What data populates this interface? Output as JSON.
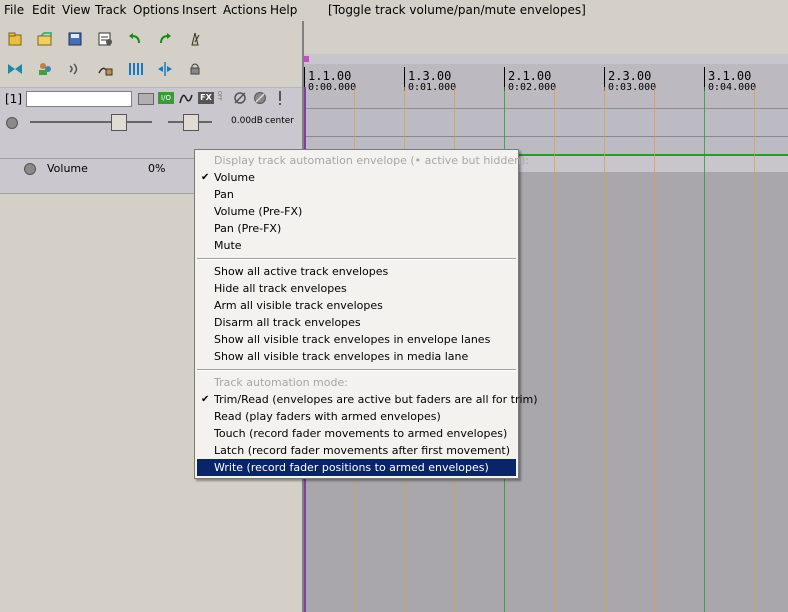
{
  "menubar": {
    "items": [
      "File",
      "Edit",
      "View",
      "Track",
      "Options",
      "Insert",
      "Actions",
      "Help"
    ],
    "status": "[Toggle track volume/pan/mute envelopes]"
  },
  "track": {
    "number": "[1]",
    "name": "",
    "volume_readout": "0.00dB",
    "pan_readout": "center",
    "fx_label": "FX",
    "off_label": "OFF",
    "io_label": "I/O"
  },
  "envelope_lane": {
    "name": "Volume",
    "value": "0%"
  },
  "ruler": {
    "bars": [
      "1.1.00",
      "1.3.00",
      "2.1.00",
      "2.3.00",
      "3.1.00"
    ],
    "times": [
      "0:00.000",
      "0:01.000",
      "0:02.000",
      "0:03.000",
      "0:04.000"
    ]
  },
  "context_menu": {
    "header1": "Display track automation envelope (• active but hidden):",
    "display_items": [
      {
        "label": "Volume",
        "checked": true
      },
      {
        "label": "Pan",
        "checked": false
      },
      {
        "label": "Volume (Pre-FX)",
        "checked": false
      },
      {
        "label": "Pan (Pre-FX)",
        "checked": false
      },
      {
        "label": "Mute",
        "checked": false
      }
    ],
    "envelope_actions": [
      "Show all active track envelopes",
      "Hide all track envelopes",
      "Arm all visible track envelopes",
      "Disarm all track envelopes",
      "Show all visible track envelopes in envelope lanes",
      "Show all visible track envelopes in media lane"
    ],
    "header2": "Track automation mode:",
    "mode_items": [
      {
        "label": "Trim/Read (envelopes are active but faders are all for trim)",
        "checked": true,
        "selected": false
      },
      {
        "label": "Read (play faders with armed envelopes)",
        "checked": false,
        "selected": false
      },
      {
        "label": "Touch (record fader movements to armed envelopes)",
        "checked": false,
        "selected": false
      },
      {
        "label": "Latch (record fader movements after first movement)",
        "checked": false,
        "selected": false
      },
      {
        "label": "Write (record fader positions to armed envelopes)",
        "checked": false,
        "selected": true
      }
    ]
  },
  "colors": {
    "envelope_green": "#2e9a2e",
    "highlight": "#0a246a",
    "grid_orange": "#d8a04a"
  }
}
